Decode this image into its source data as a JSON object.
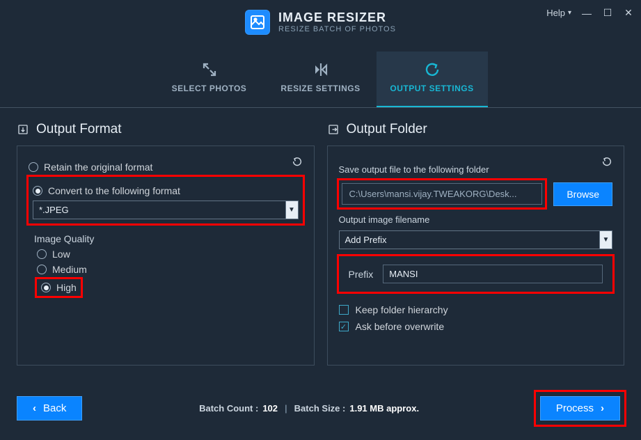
{
  "brand": {
    "title": "IMAGE RESIZER",
    "subtitle": "RESIZE BATCH OF PHOTOS"
  },
  "window": {
    "help": "Help"
  },
  "tabs": {
    "select": "SELECT PHOTOS",
    "resize": "RESIZE SETTINGS",
    "output": "OUTPUT SETTINGS"
  },
  "outputFormat": {
    "heading": "Output Format",
    "retainLabel": "Retain the original format",
    "convertLabel": "Convert to the following format",
    "formatValue": "*.JPEG",
    "qualityHeading": "Image Quality",
    "quality": {
      "low": "Low",
      "medium": "Medium",
      "high": "High"
    }
  },
  "outputFolder": {
    "heading": "Output Folder",
    "saveLabel": "Save output file to the following folder",
    "path": "C:\\Users\\mansi.vijay.TWEAKORG\\Desk...",
    "browse": "Browse",
    "filenameLabel": "Output image filename",
    "filenameMode": "Add Prefix",
    "prefixLabel": "Prefix",
    "prefixValue": "MANSI",
    "keepHierarchy": "Keep folder hierarchy",
    "askOverwrite": "Ask before overwrite"
  },
  "footer": {
    "back": "Back",
    "process": "Process",
    "batchCountLabel": "Batch Count :",
    "batchCount": "102",
    "batchSizeLabel": "Batch Size :",
    "batchSize": "1.91 MB approx."
  }
}
